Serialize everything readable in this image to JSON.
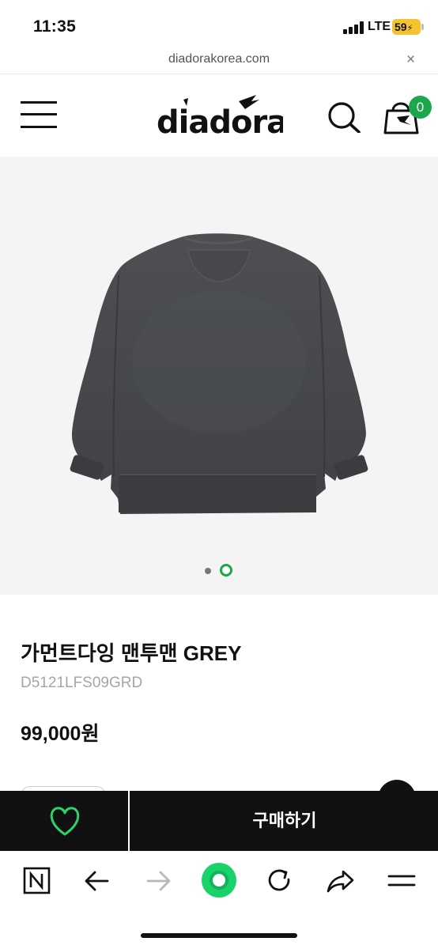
{
  "status_bar": {
    "time": "11:35",
    "network": "LTE",
    "battery": "59"
  },
  "url_bar": {
    "url": "diadorakorea.com",
    "close_glyph": "×"
  },
  "header": {
    "brand": "diadora",
    "menu_icon": "hamburger-menu-icon",
    "search_icon": "search-icon",
    "cart_icon": "shopping-bag-icon",
    "cart_count": "0"
  },
  "gallery": {
    "current_slide": 2,
    "total_slides": 2
  },
  "product": {
    "name": "가먼트다잉 맨투맨 GREY",
    "code": "D5121LFS09GRD",
    "price": "99,000원"
  },
  "buy_bar": {
    "wishlist_icon": "heart-outline-icon",
    "buy_label": "구매하기"
  },
  "browser_toolbar": {
    "items": [
      "naver-n-icon",
      "back-arrow-icon",
      "forward-arrow-icon",
      "green-dot-icon",
      "reload-icon",
      "share-icon",
      "menu-icon"
    ]
  },
  "colors": {
    "accent_green": "#1aa84a",
    "dark": "#111111",
    "image_bg": "#f4f4f4",
    "battery_yellow": "#f4c430"
  }
}
